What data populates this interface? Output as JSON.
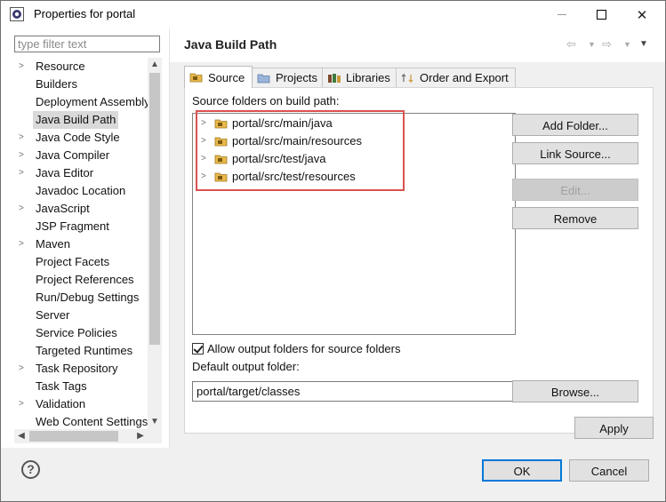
{
  "window": {
    "title": "Properties for portal",
    "controls": {
      "minimize": "minimize",
      "maximize": "maximize",
      "close": "✕"
    }
  },
  "filter": {
    "placeholder": "type filter text",
    "value": ""
  },
  "tree": {
    "items": [
      {
        "label": "Resource",
        "expandable": true,
        "selected": false
      },
      {
        "label": "Builders",
        "expandable": false,
        "selected": false
      },
      {
        "label": "Deployment Assembly",
        "expandable": false,
        "selected": false
      },
      {
        "label": "Java Build Path",
        "expandable": false,
        "selected": true
      },
      {
        "label": "Java Code Style",
        "expandable": true,
        "selected": false
      },
      {
        "label": "Java Compiler",
        "expandable": true,
        "selected": false
      },
      {
        "label": "Java Editor",
        "expandable": true,
        "selected": false
      },
      {
        "label": "Javadoc Location",
        "expandable": false,
        "selected": false
      },
      {
        "label": "JavaScript",
        "expandable": true,
        "selected": false
      },
      {
        "label": "JSP Fragment",
        "expandable": false,
        "selected": false
      },
      {
        "label": "Maven",
        "expandable": true,
        "selected": false
      },
      {
        "label": "Project Facets",
        "expandable": false,
        "selected": false
      },
      {
        "label": "Project References",
        "expandable": false,
        "selected": false
      },
      {
        "label": "Run/Debug Settings",
        "expandable": false,
        "selected": false
      },
      {
        "label": "Server",
        "expandable": false,
        "selected": false
      },
      {
        "label": "Service Policies",
        "expandable": false,
        "selected": false
      },
      {
        "label": "Targeted Runtimes",
        "expandable": false,
        "selected": false
      },
      {
        "label": "Task Repository",
        "expandable": true,
        "selected": false
      },
      {
        "label": "Task Tags",
        "expandable": false,
        "selected": false
      },
      {
        "label": "Validation",
        "expandable": true,
        "selected": false
      },
      {
        "label": "Web Content Settings",
        "expandable": false,
        "selected": false
      }
    ]
  },
  "page": {
    "title": "Java Build Path",
    "nav": {
      "back": "⇦",
      "back_menu": "▼",
      "forward": "⇨",
      "forward_menu": "▼",
      "view_menu": "▼"
    }
  },
  "tabs": [
    {
      "label": "Source",
      "active": true,
      "icon": "source-folder-icon"
    },
    {
      "label": "Projects",
      "active": false,
      "icon": "projects-folder-icon"
    },
    {
      "label": "Libraries",
      "active": false,
      "icon": "libraries-icon"
    },
    {
      "label": "Order and Export",
      "active": false,
      "icon": "order-export-icon"
    }
  ],
  "source": {
    "label": "Source folders on build path:",
    "folders": [
      "portal/src/main/java",
      "portal/src/main/resources",
      "portal/src/test/java",
      "portal/src/test/resources"
    ],
    "highlight_color": "#d9534f"
  },
  "buttons": {
    "add_folder": "Add Folder...",
    "link_source": "Link Source...",
    "edit": "Edit...",
    "remove": "Remove",
    "browse": "Browse...",
    "apply": "Apply",
    "ok": "OK",
    "cancel": "Cancel"
  },
  "output": {
    "allow_label": "Allow output folders for source folders",
    "allow_checked": true,
    "default_label": "Default output folder:",
    "default_value": "portal/target/classes"
  },
  "help": {
    "glyph": "?"
  },
  "colors": {
    "accent": "#0078d7",
    "folder": "#e8b84a"
  }
}
